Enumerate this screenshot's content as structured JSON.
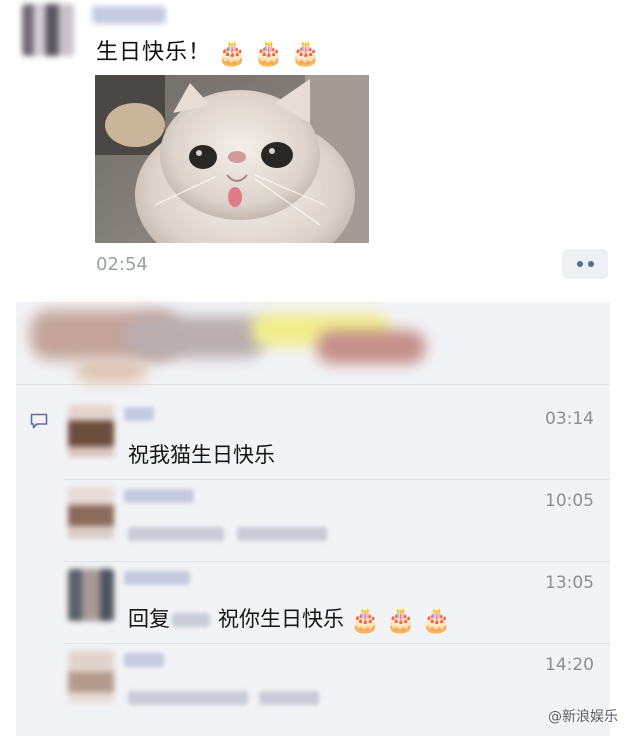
{
  "post": {
    "text": "生日快乐！",
    "emoji": [
      "🎂",
      "🎂",
      "🎂"
    ],
    "time": "02:54"
  },
  "comments": [
    {
      "time": "03:14",
      "text": "祝我猫生日快乐"
    },
    {
      "time": "10:05"
    },
    {
      "time": "13:05",
      "text_prefix": "回复",
      "text": "祝你生日快乐",
      "emoji": [
        "🎂",
        "🎂",
        "🎂"
      ]
    },
    {
      "time": "14:20"
    }
  ],
  "watermark": "@新浪娱乐",
  "icons": {
    "comment": "comment-icon",
    "more": "more-dots-icon"
  }
}
